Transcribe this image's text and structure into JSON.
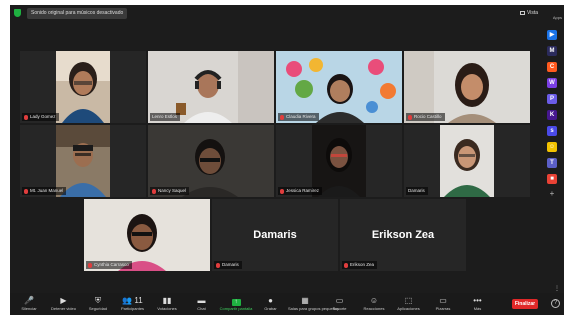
{
  "topbar": {
    "notice": "Sonido original para músicos desactivado",
    "view_label": "Vista",
    "apps_label": "Apps"
  },
  "participants": [
    {
      "name": "Lady Gomez",
      "muted": true
    },
    {
      "name": "Lenro Estlos",
      "muted": false
    },
    {
      "name": "Claudia Rivera",
      "muted": true
    },
    {
      "name": "Rocio Castillo",
      "muted": true
    },
    {
      "name": "Mt. Juan Manuel",
      "muted": true
    },
    {
      "name": "Nancy Saquel",
      "muted": true
    },
    {
      "name": "Jessica Ramirez",
      "muted": true
    },
    {
      "name": "Damaris",
      "muted": false
    },
    {
      "name": "Cynthia Carrasco",
      "muted": true
    },
    {
      "name": "Damaris",
      "muted": true,
      "display": "Damaris"
    },
    {
      "name": "Erikson Zea",
      "muted": true,
      "display": "Erikson Zea"
    }
  ],
  "sidebar_apps": [
    {
      "icon": "zoom-apps-icon",
      "color": "#1a73e8",
      "glyph": "▶"
    },
    {
      "icon": "miro-icon",
      "color": "#2b2b5c",
      "glyph": "M"
    },
    {
      "icon": "cap-icon",
      "color": "#ff5a1f",
      "glyph": "C"
    },
    {
      "icon": "workflow-icon",
      "color": "#7b3fe4",
      "glyph": "W"
    },
    {
      "icon": "polly-icon",
      "color": "#6b5ce7",
      "glyph": "P"
    },
    {
      "icon": "kahoot-icon",
      "color": "#46178f",
      "glyph": "K"
    },
    {
      "icon": "slack-icon",
      "color": "#4a4ae8",
      "glyph": "s"
    },
    {
      "icon": "emoji-app-icon",
      "color": "#f2c200",
      "glyph": "☺"
    },
    {
      "icon": "teams-app-icon",
      "color": "#5b5fc7",
      "glyph": "T"
    },
    {
      "icon": "color-app-icon",
      "color": "#e94235",
      "glyph": "■"
    }
  ],
  "toolbar": {
    "items": [
      {
        "icon": "mic-icon",
        "glyph": "🎤",
        "label": "Silenciar"
      },
      {
        "icon": "video-icon",
        "glyph": "▶",
        "label": "Detener video"
      },
      {
        "icon": "security-icon",
        "glyph": "⛨",
        "label": "Seguridad"
      },
      {
        "icon": "participants-icon",
        "glyph": "👥 11",
        "label": "Participantes"
      },
      {
        "icon": "polls-icon",
        "glyph": "▮▮",
        "label": "Votaciones"
      },
      {
        "icon": "chat-icon",
        "glyph": "▬",
        "label": "Chat"
      },
      {
        "icon": "share-screen-icon",
        "glyph": "↑",
        "label": "Compartir pantalla",
        "green": true
      },
      {
        "icon": "record-icon",
        "glyph": "●",
        "label": "Grabar"
      },
      {
        "icon": "breakout-icon",
        "glyph": "▦",
        "label": "Salas para grupos pequeños"
      },
      {
        "icon": "support-icon",
        "glyph": "▭",
        "label": "Soporte"
      },
      {
        "icon": "reactions-icon",
        "glyph": "☺",
        "label": "Reacciones"
      },
      {
        "icon": "apps-icon",
        "glyph": "⬚",
        "label": "Aplicaciones"
      },
      {
        "icon": "whiteboards-icon",
        "glyph": "▭",
        "label": "Pizarras"
      },
      {
        "icon": "more-icon",
        "glyph": "•••",
        "label": "Más"
      }
    ],
    "end_label": "Finalizar",
    "help_glyph": "?"
  }
}
